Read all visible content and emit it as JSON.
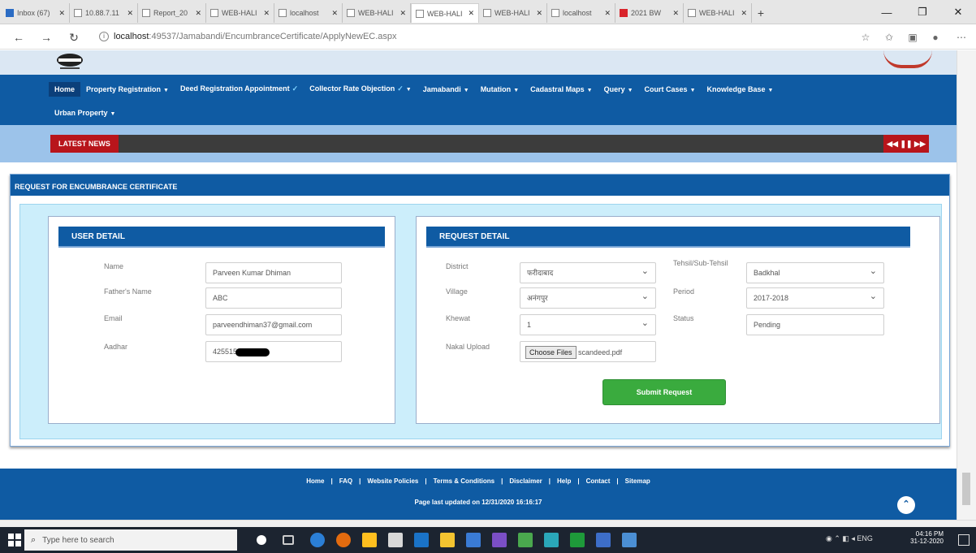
{
  "browser": {
    "tabs": [
      {
        "title": "Inbox (67)",
        "active": false
      },
      {
        "title": "10.88.7.11",
        "active": false
      },
      {
        "title": "Report_20",
        "active": false
      },
      {
        "title": "WEB-HALI",
        "active": false
      },
      {
        "title": "localhost",
        "active": false
      },
      {
        "title": "WEB-HALI",
        "active": false
      },
      {
        "title": "WEB-HALI",
        "active": true
      },
      {
        "title": "WEB-HALI",
        "active": false
      },
      {
        "title": "localhost",
        "active": false
      },
      {
        "title": "2021 BW",
        "active": false
      },
      {
        "title": "WEB-HALI",
        "active": false
      }
    ],
    "url_host": "localhost",
    "url_rest": ":49537/Jamabandi/EncumbranceCertificate/ApplyNewEC.aspx"
  },
  "nav": {
    "row1": [
      {
        "label": "Home",
        "caret": false,
        "isNew": false
      },
      {
        "label": "Property Registration",
        "caret": true,
        "isNew": false
      },
      {
        "label": "Deed Registration Appointment",
        "caret": false,
        "isNew": true
      },
      {
        "label": "Collector Rate Objection",
        "caret": true,
        "isNew": true
      },
      {
        "label": "Jamabandi",
        "caret": true,
        "isNew": false
      },
      {
        "label": "Mutation",
        "caret": true,
        "isNew": false
      },
      {
        "label": "Cadastral Maps",
        "caret": true,
        "isNew": false
      },
      {
        "label": "Query",
        "caret": true,
        "isNew": false
      },
      {
        "label": "Court Cases",
        "caret": true,
        "isNew": false
      },
      {
        "label": "Knowledge Base",
        "caret": true,
        "isNew": false
      }
    ],
    "row2": [
      {
        "label": "Urban Property",
        "caret": true,
        "isNew": false
      }
    ]
  },
  "news": {
    "label": "LATEST NEWS",
    "controls": "◀◀ ❚❚ ▶▶"
  },
  "panel": {
    "title": "REQUEST FOR ENCUMBRANCE CERTIFICATE"
  },
  "user_detail": {
    "heading": "USER DETAIL",
    "name_label": "Name",
    "name_value": "Parveen Kumar Dhiman",
    "father_label": "Father's Name",
    "father_value": "ABC",
    "email_label": "Email",
    "email_value": "parveendhiman37@gmail.com",
    "aadhar_label": "Aadhar",
    "aadhar_value": "425515"
  },
  "request_detail": {
    "heading": "REQUEST DETAIL",
    "district_label": "District",
    "district_value": "फरीदाबाद",
    "tehsil_label": "Tehsil/Sub-Tehsil",
    "tehsil_value": "Badkhal",
    "village_label": "Village",
    "village_value": "अनंगपुर",
    "period_label": "Period",
    "period_value": "2017-2018",
    "khewat_label": "Khewat",
    "khewat_value": "1",
    "status_label": "Status",
    "status_value": "Pending",
    "nakal_label": "Nakal Upload",
    "choose_label": "Choose Files",
    "file_name": "scandeed.pdf",
    "submit_label": "Submit Request"
  },
  "footer": {
    "links": [
      "Home",
      "FAQ",
      "Website Policies",
      "Terms & Conditions",
      "Disclaimer",
      "Help",
      "Contact",
      "Sitemap"
    ],
    "updated": "Page last updated on 12/31/2020 16:16:17"
  },
  "taskbar": {
    "search_placeholder": "Type here to search",
    "lang": "ENG",
    "time": "04:16 PM",
    "date": "31-12-2020"
  },
  "colors": {
    "brand_blue": "#0f5ba3",
    "news_red": "#b8151b",
    "submit_green": "#3aab3e",
    "panel_bg": "#cceefb"
  }
}
